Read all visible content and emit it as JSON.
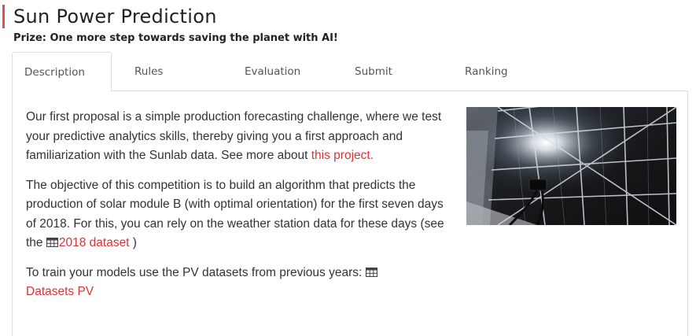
{
  "page": {
    "title": "Sun Power Prediction",
    "prize": "Prize: One more step towards saving the planet with AI!",
    "accent_color": "#d9534f",
    "link_color": "#d9343a"
  },
  "tabs": [
    {
      "label": "Description",
      "active": true
    },
    {
      "label": "Rules",
      "active": false
    },
    {
      "label": "Evaluation",
      "active": false
    },
    {
      "label": "Submit",
      "active": false
    },
    {
      "label": "Ranking",
      "active": false
    }
  ],
  "description": {
    "p1_text": "Our first proposal is a simple production forecasting challenge, where we test your predictive analytics skills, thereby giving you a first approach and familiarization with the Sunlab data. See more about ",
    "p1_link": "this project.",
    "p2_text": "The objective of this competition is to build an algorithm that predicts the production of solar module B (with optimal orientation) for the first seven days of 2018. For this, you can rely on the weather station data for these days (see the ",
    "p2_link": "2018 dataset",
    "p2_tail": " )",
    "p3_text": "To train your models use the PV datasets from previous years: ",
    "p3_link": "Datasets PV",
    "table_icon": "table-icon"
  },
  "image": {
    "subject": "solar-panel-photo"
  }
}
